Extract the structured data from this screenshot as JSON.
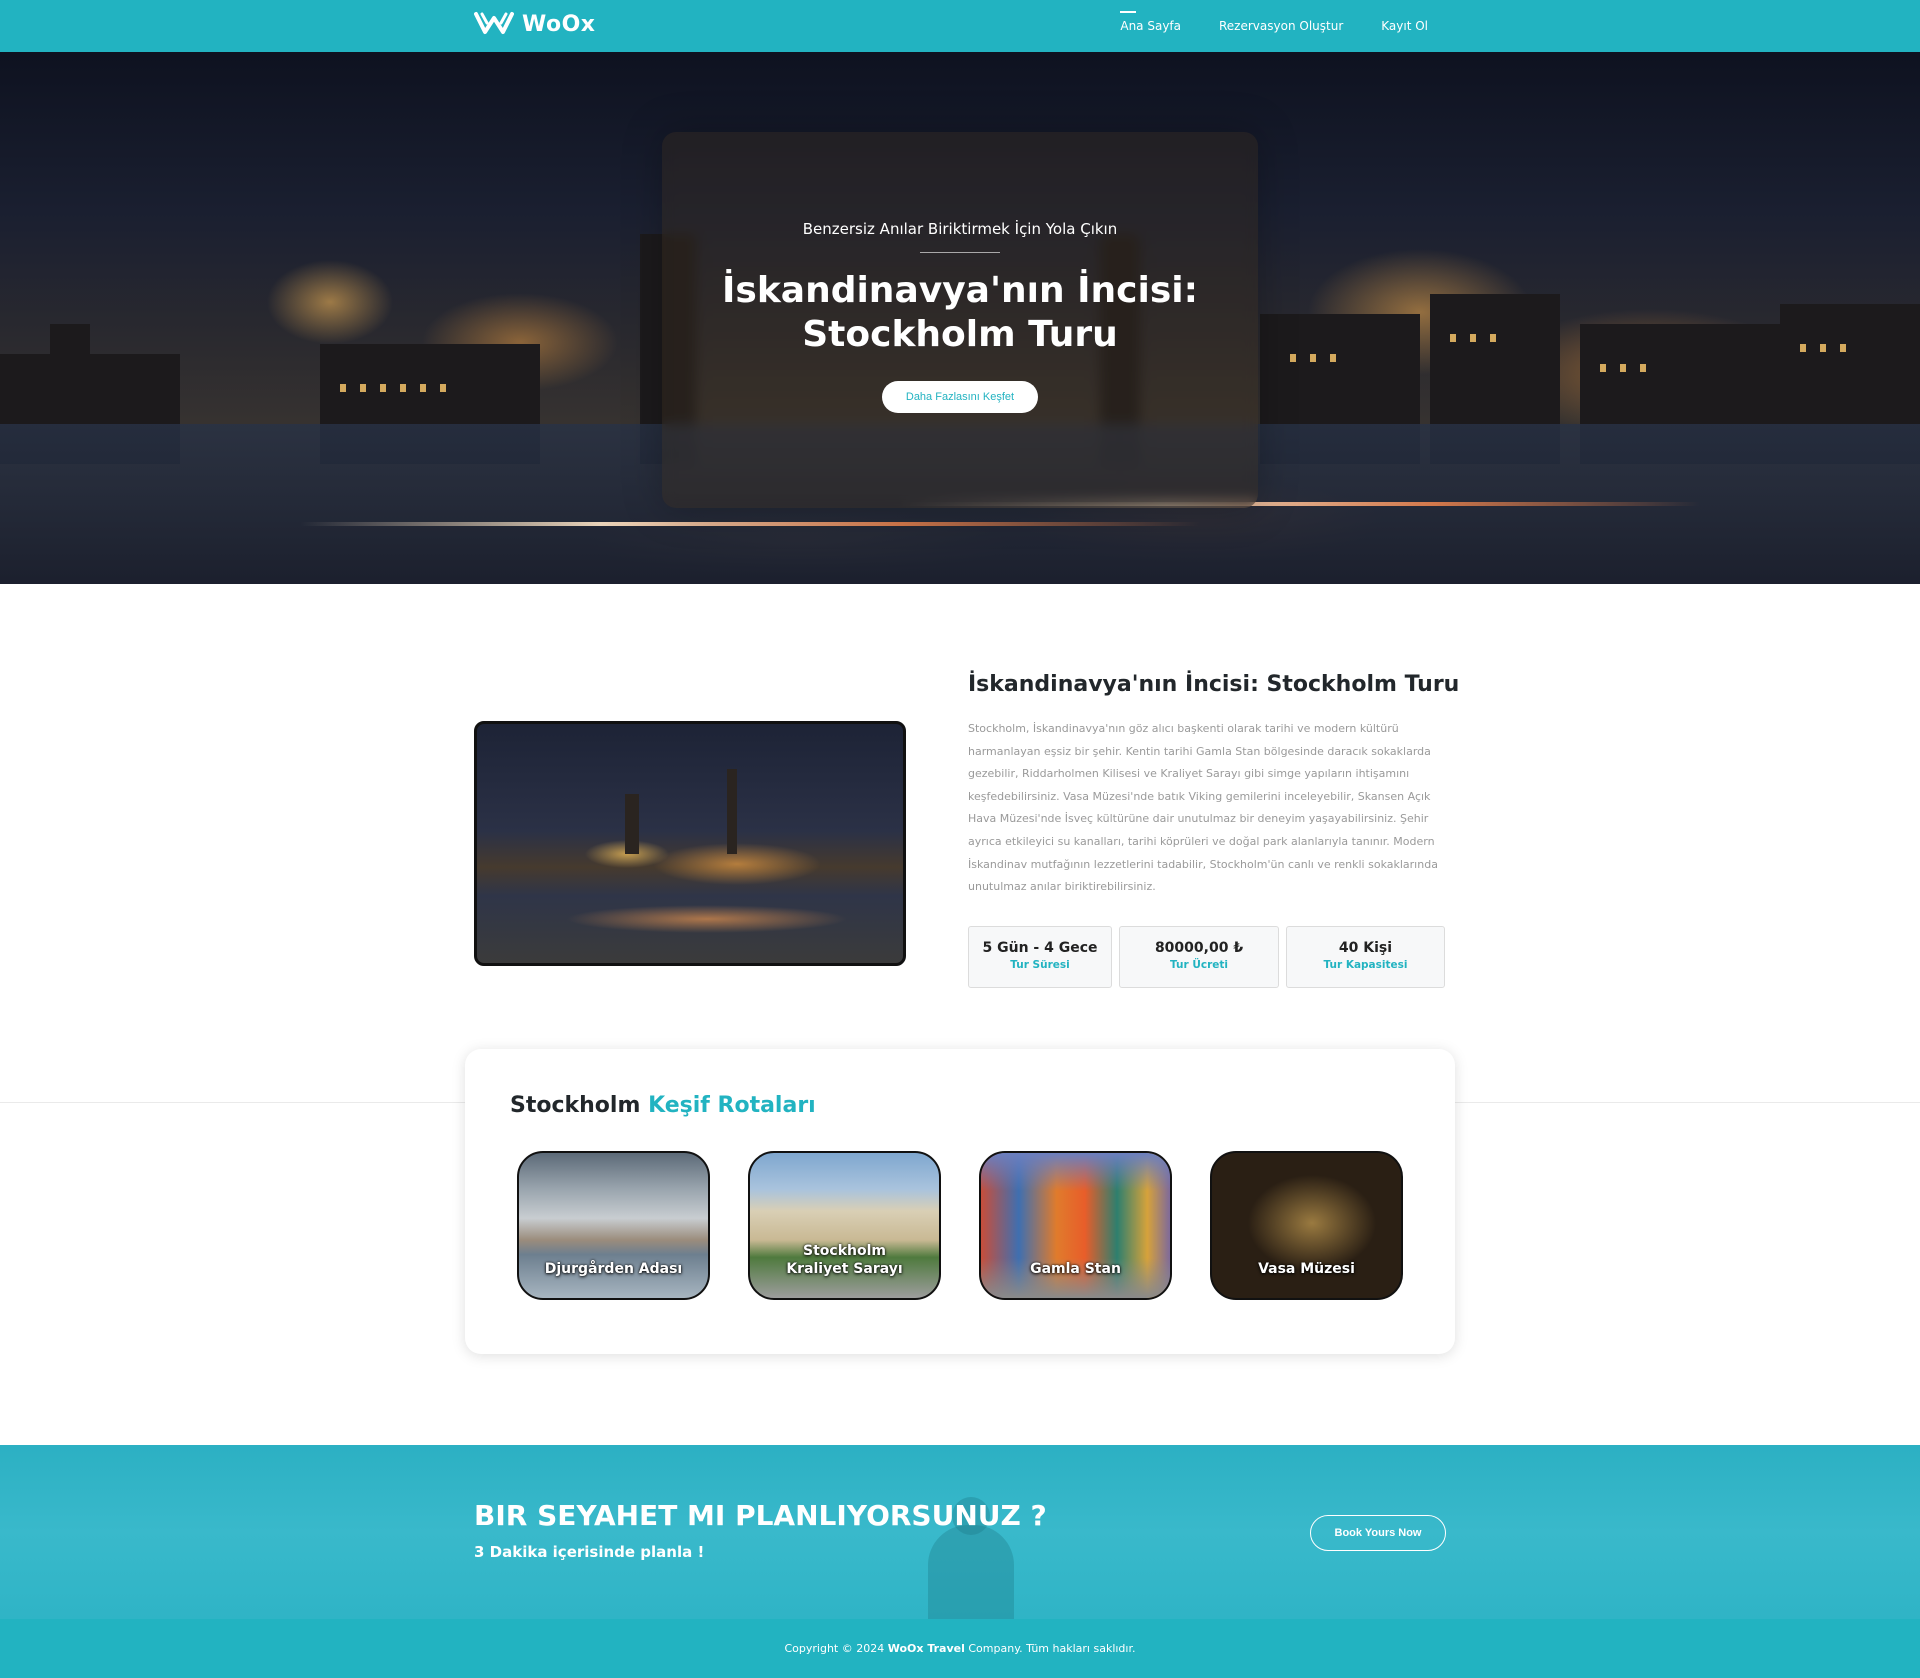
{
  "header": {
    "brand": "WoOx",
    "nav": [
      {
        "label": "Ana Sayfa",
        "active": true
      },
      {
        "label": "Rezervasyon Oluştur",
        "active": false
      },
      {
        "label": "Kayıt Ol",
        "active": false
      }
    ]
  },
  "hero": {
    "subtitle": "Benzersiz Anılar Biriktirmek İçin Yola Çıkın",
    "title": "İskandinavya'nın İncisi: Stockholm Turu",
    "button": "Daha Fazlasını Keşfet"
  },
  "about": {
    "title": "İskandinavya'nın İncisi: Stockholm Turu",
    "text": "Stockholm, İskandinavya'nın göz alıcı başkenti olarak tarihi ve modern kültürü harmanlayan eşsiz bir şehir. Kentin tarihi Gamla Stan bölgesinde daracık sokaklarda gezebilir, Riddarholmen Kilisesi ve Kraliyet Sarayı gibi simge yapıların ihtişamını keşfedebilirsiniz. Vasa Müzesi'nde batık Viking gemilerini inceleyebilir, Skansen Açık Hava Müzesi'nde İsveç kültürüne dair unutulmaz bir deneyim yaşayabilirsiniz. Şehir ayrıca etkileyici su kanalları, tarihi köprüleri ve doğal park alanlarıyla tanınır. Modern İskandinav mutfağının lezzetlerini tadabilir, Stockholm'ün canlı ve renkli sokaklarında unutulmaz anılar biriktirebilirsiniz.",
    "stats": [
      {
        "value": "5 Gün - 4 Gece",
        "label": "Tur Süresi"
      },
      {
        "value": "80000,00 ₺",
        "label": "Tur Ücreti"
      },
      {
        "value": "40 Kişi",
        "label": "Tur Kapasitesi"
      }
    ]
  },
  "routes": {
    "title_main": "Stockholm",
    "title_accent": "Keşif Rotaları",
    "items": [
      {
        "label": "Djurgården Adası"
      },
      {
        "label": "Stockholm Kraliyet Sarayı"
      },
      {
        "label": "Gamla Stan"
      },
      {
        "label": "Vasa Müzesi"
      }
    ]
  },
  "cta": {
    "title": "BIR SEYAHET MI PLANLIYORSUNUZ ?",
    "subtitle": "3 Dakika içerisinde planla !",
    "button": "Book Yours Now"
  },
  "footer": {
    "prefix": "Copyright © 2024",
    "company": "WoOx Travel",
    "suffix": "Company. Tüm hakları saklıdır."
  },
  "colors": {
    "accent": "#22b3c1",
    "heading": "#22272b",
    "body_text": "#9a9a9a"
  }
}
